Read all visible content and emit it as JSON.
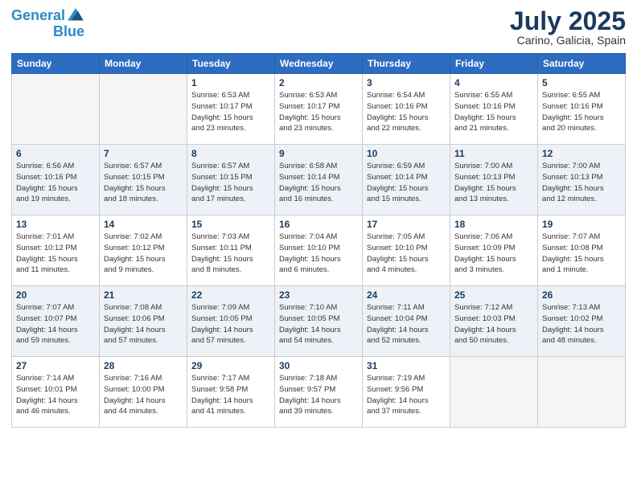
{
  "header": {
    "logo_line1": "General",
    "logo_line2": "Blue",
    "month": "July 2025",
    "location": "Carino, Galicia, Spain"
  },
  "days_of_week": [
    "Sunday",
    "Monday",
    "Tuesday",
    "Wednesday",
    "Thursday",
    "Friday",
    "Saturday"
  ],
  "weeks": [
    [
      {
        "day": "",
        "info": ""
      },
      {
        "day": "",
        "info": ""
      },
      {
        "day": "1",
        "info": "Sunrise: 6:53 AM\nSunset: 10:17 PM\nDaylight: 15 hours\nand 23 minutes."
      },
      {
        "day": "2",
        "info": "Sunrise: 6:53 AM\nSunset: 10:17 PM\nDaylight: 15 hours\nand 23 minutes."
      },
      {
        "day": "3",
        "info": "Sunrise: 6:54 AM\nSunset: 10:16 PM\nDaylight: 15 hours\nand 22 minutes."
      },
      {
        "day": "4",
        "info": "Sunrise: 6:55 AM\nSunset: 10:16 PM\nDaylight: 15 hours\nand 21 minutes."
      },
      {
        "day": "5",
        "info": "Sunrise: 6:55 AM\nSunset: 10:16 PM\nDaylight: 15 hours\nand 20 minutes."
      }
    ],
    [
      {
        "day": "6",
        "info": "Sunrise: 6:56 AM\nSunset: 10:16 PM\nDaylight: 15 hours\nand 19 minutes."
      },
      {
        "day": "7",
        "info": "Sunrise: 6:57 AM\nSunset: 10:15 PM\nDaylight: 15 hours\nand 18 minutes."
      },
      {
        "day": "8",
        "info": "Sunrise: 6:57 AM\nSunset: 10:15 PM\nDaylight: 15 hours\nand 17 minutes."
      },
      {
        "day": "9",
        "info": "Sunrise: 6:58 AM\nSunset: 10:14 PM\nDaylight: 15 hours\nand 16 minutes."
      },
      {
        "day": "10",
        "info": "Sunrise: 6:59 AM\nSunset: 10:14 PM\nDaylight: 15 hours\nand 15 minutes."
      },
      {
        "day": "11",
        "info": "Sunrise: 7:00 AM\nSunset: 10:13 PM\nDaylight: 15 hours\nand 13 minutes."
      },
      {
        "day": "12",
        "info": "Sunrise: 7:00 AM\nSunset: 10:13 PM\nDaylight: 15 hours\nand 12 minutes."
      }
    ],
    [
      {
        "day": "13",
        "info": "Sunrise: 7:01 AM\nSunset: 10:12 PM\nDaylight: 15 hours\nand 11 minutes."
      },
      {
        "day": "14",
        "info": "Sunrise: 7:02 AM\nSunset: 10:12 PM\nDaylight: 15 hours\nand 9 minutes."
      },
      {
        "day": "15",
        "info": "Sunrise: 7:03 AM\nSunset: 10:11 PM\nDaylight: 15 hours\nand 8 minutes."
      },
      {
        "day": "16",
        "info": "Sunrise: 7:04 AM\nSunset: 10:10 PM\nDaylight: 15 hours\nand 6 minutes."
      },
      {
        "day": "17",
        "info": "Sunrise: 7:05 AM\nSunset: 10:10 PM\nDaylight: 15 hours\nand 4 minutes."
      },
      {
        "day": "18",
        "info": "Sunrise: 7:06 AM\nSunset: 10:09 PM\nDaylight: 15 hours\nand 3 minutes."
      },
      {
        "day": "19",
        "info": "Sunrise: 7:07 AM\nSunset: 10:08 PM\nDaylight: 15 hours\nand 1 minute."
      }
    ],
    [
      {
        "day": "20",
        "info": "Sunrise: 7:07 AM\nSunset: 10:07 PM\nDaylight: 14 hours\nand 59 minutes."
      },
      {
        "day": "21",
        "info": "Sunrise: 7:08 AM\nSunset: 10:06 PM\nDaylight: 14 hours\nand 57 minutes."
      },
      {
        "day": "22",
        "info": "Sunrise: 7:09 AM\nSunset: 10:05 PM\nDaylight: 14 hours\nand 57 minutes."
      },
      {
        "day": "23",
        "info": "Sunrise: 7:10 AM\nSunset: 10:05 PM\nDaylight: 14 hours\nand 54 minutes."
      },
      {
        "day": "24",
        "info": "Sunrise: 7:11 AM\nSunset: 10:04 PM\nDaylight: 14 hours\nand 52 minutes."
      },
      {
        "day": "25",
        "info": "Sunrise: 7:12 AM\nSunset: 10:03 PM\nDaylight: 14 hours\nand 50 minutes."
      },
      {
        "day": "26",
        "info": "Sunrise: 7:13 AM\nSunset: 10:02 PM\nDaylight: 14 hours\nand 48 minutes."
      }
    ],
    [
      {
        "day": "27",
        "info": "Sunrise: 7:14 AM\nSunset: 10:01 PM\nDaylight: 14 hours\nand 46 minutes."
      },
      {
        "day": "28",
        "info": "Sunrise: 7:16 AM\nSunset: 10:00 PM\nDaylight: 14 hours\nand 44 minutes."
      },
      {
        "day": "29",
        "info": "Sunrise: 7:17 AM\nSunset: 9:58 PM\nDaylight: 14 hours\nand 41 minutes."
      },
      {
        "day": "30",
        "info": "Sunrise: 7:18 AM\nSunset: 9:57 PM\nDaylight: 14 hours\nand 39 minutes."
      },
      {
        "day": "31",
        "info": "Sunrise: 7:19 AM\nSunset: 9:56 PM\nDaylight: 14 hours\nand 37 minutes."
      },
      {
        "day": "",
        "info": ""
      },
      {
        "day": "",
        "info": ""
      }
    ]
  ]
}
